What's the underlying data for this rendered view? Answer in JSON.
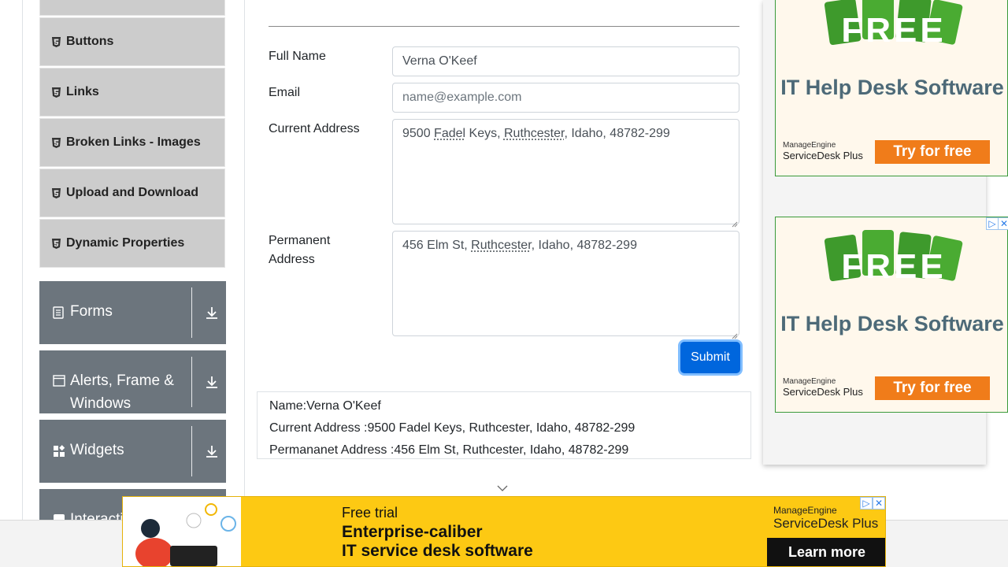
{
  "sidebar": {
    "elements_items": [
      {
        "label": "Buttons"
      },
      {
        "label": "Links"
      },
      {
        "label": "Broken Links - Images"
      },
      {
        "label": "Upload and Download"
      },
      {
        "label": "Dynamic Properties"
      }
    ],
    "groups": [
      {
        "label": "Forms",
        "icon": "document-icon"
      },
      {
        "label": "Alerts, Frame &",
        "label_line2": "Windows",
        "icon": "window-icon"
      },
      {
        "label": "Widgets",
        "icon": "widgets-icon"
      },
      {
        "label": "Interacti",
        "icon": "interactions-icon"
      }
    ]
  },
  "form": {
    "full_name": {
      "label": "Full Name",
      "value": "Verna O'Keef"
    },
    "email": {
      "label": "Email",
      "placeholder": "name@example.com"
    },
    "current_address": {
      "label": "Current Address",
      "value_parts": [
        "9500 ",
        "Fadel",
        " Keys, ",
        "Ruthcester",
        ", Idaho, 48782-299"
      ]
    },
    "permanent_address": {
      "label_line1": "Permanent",
      "label_line2": "Address",
      "value_parts": [
        "456 Elm St, ",
        "Ruthcester",
        ", Idaho, 48782-299"
      ]
    },
    "submit_label": "Submit"
  },
  "output": {
    "name": "Name:Verna O'Keef",
    "current_address": "Current Address :9500 Fadel Keys, Ruthcester, Idaho, 48782-299",
    "permanent_address": "Permananet Address :456 Elm St, Ruthcester, Idaho, 48782-299"
  },
  "side_ads": [
    {
      "free": "FREE",
      "tagline": "IT Help Desk Software",
      "brand_top": "ManageEngine",
      "brand_bottom": "ServiceDesk Plus",
      "cta": "Try for free"
    },
    {
      "free": "FREE",
      "tagline": "IT Help Desk Software",
      "brand_top": "ManageEngine",
      "brand_bottom": "ServiceDesk Plus",
      "cta": "Try for free"
    }
  ],
  "bottom_ad": {
    "line1": "Free trial",
    "line2": "Enterprise-caliber",
    "line3": "IT service desk software",
    "brand_top": "ManageEngine",
    "brand_bottom": "ServiceDesk Plus",
    "cta": "Learn more"
  },
  "colors": {
    "sidebar_group": "#6c757d",
    "sidebar_item": "#cccccc",
    "submit": "#0066dd",
    "banner": "#fdc913",
    "cta_orange": "#f07c1a"
  }
}
